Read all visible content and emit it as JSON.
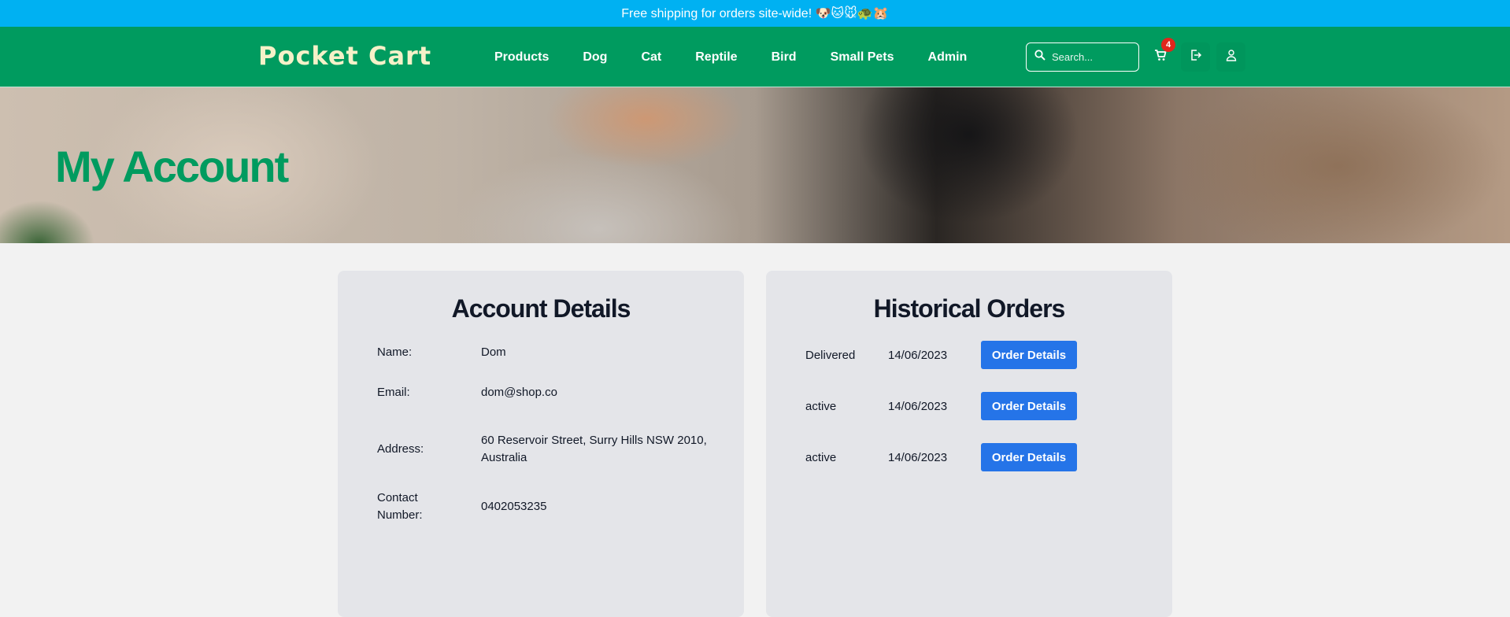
{
  "promo": {
    "text": "Free shipping for orders site-wide! 🐶🐱🐭🐢🐹"
  },
  "header": {
    "logo": "Pocket Cart",
    "nav": [
      "Products",
      "Dog",
      "Cat",
      "Reptile",
      "Bird",
      "Small Pets",
      "Admin"
    ],
    "search_placeholder": "Search...",
    "cart_count": "4",
    "icons": [
      "search-icon",
      "cart-icon",
      "logout-icon",
      "user-icon"
    ]
  },
  "hero": {
    "title": "My Account"
  },
  "account": {
    "title": "Account Details",
    "rows": [
      {
        "label": "Name:",
        "value": "Dom"
      },
      {
        "label": "Email:",
        "value": "dom@shop.co"
      },
      {
        "label": "Address:",
        "value": "60 Reservoir Street, Surry Hills NSW 2010, Australia"
      },
      {
        "label": "Contact Number:",
        "value": "0402053235"
      }
    ]
  },
  "orders": {
    "title": "Historical Orders",
    "button_label": "Order Details",
    "rows": [
      {
        "status": "Delivered",
        "date": "14/06/2023"
      },
      {
        "status": "active",
        "date": "14/06/2023"
      },
      {
        "status": "active",
        "date": "14/06/2023"
      }
    ]
  },
  "colors": {
    "promo": "#00b1f2",
    "nav": "#009b5f",
    "button": "#2574e8",
    "badge": "#e1261c"
  }
}
